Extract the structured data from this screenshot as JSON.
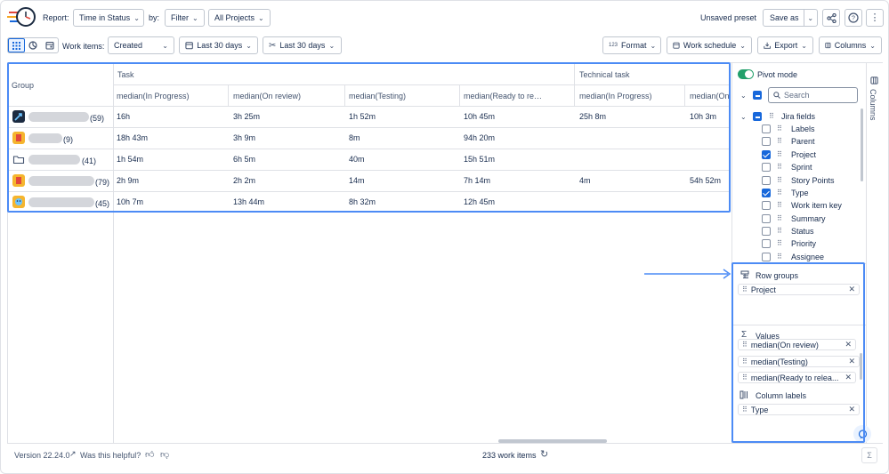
{
  "toolbar": {
    "report_label": "Report:",
    "report_value": "Time in Status",
    "by_label": "by:",
    "filter_value": "Filter",
    "projects_value": "All Projects",
    "unsaved_preset": "Unsaved preset",
    "save_as": "Save as"
  },
  "subbar": {
    "work_items_label": "Work items:",
    "created_value": "Created",
    "date1": "Last 30 days",
    "date2": "Last 30 days",
    "format_prefix": "123",
    "format": "Format",
    "work_schedule": "Work schedule",
    "export": "Export",
    "columns": "Columns"
  },
  "table": {
    "group_header": "Group",
    "type_headers": [
      "Task",
      "Technical task"
    ],
    "columns": [
      "median(In Progress)",
      "median(On review)",
      "median(Testing)",
      "median(Ready to re…",
      "median(In Progress)",
      "median(On"
    ],
    "rows": [
      {
        "count": "(59)",
        "cells": [
          "16h",
          "3h 25m",
          "1h 52m",
          "10h 45m",
          "25h 8m",
          "10h 3m"
        ]
      },
      {
        "count": "(9)",
        "cells": [
          "18h 43m",
          "3h 9m",
          "8m",
          "94h 20m",
          "",
          ""
        ]
      },
      {
        "count": "(41)",
        "cells": [
          "1h 54m",
          "6h 5m",
          "40m",
          "15h 51m",
          "",
          ""
        ]
      },
      {
        "count": "(79)",
        "cells": [
          "2h 9m",
          "2h 2m",
          "14m",
          "7h 14m",
          "4m",
          "54h 52m"
        ]
      },
      {
        "count": "(45)",
        "cells": [
          "10h 7m",
          "13h 44m",
          "8h 32m",
          "12h 45m",
          "",
          ""
        ]
      }
    ]
  },
  "panel": {
    "pivot_mode": "Pivot mode",
    "search_placeholder": "Search",
    "jira_fields": "Jira fields",
    "side_tab": "Columns",
    "fields": [
      {
        "label": "Labels",
        "checked": false
      },
      {
        "label": "Parent",
        "checked": false
      },
      {
        "label": "Project",
        "checked": true
      },
      {
        "label": "Sprint",
        "checked": false
      },
      {
        "label": "Story Points",
        "checked": false
      },
      {
        "label": "Type",
        "checked": true
      },
      {
        "label": "Work item key",
        "checked": false
      },
      {
        "label": "Summary",
        "checked": false
      },
      {
        "label": "Status",
        "checked": false
      },
      {
        "label": "Priority",
        "checked": false
      },
      {
        "label": "Assignee",
        "checked": false
      }
    ],
    "row_groups_title": "Row groups",
    "row_groups": [
      "Project"
    ],
    "values_title": "Values",
    "values": [
      "median(On review)",
      "median(Testing)",
      "median(Ready to relea..."
    ],
    "column_labels_title": "Column labels",
    "column_labels": [
      "Type"
    ]
  },
  "footer": {
    "version": "Version 22.24.0",
    "helpful": "Was this helpful?",
    "work_items": "233 work items"
  },
  "colors": {
    "accent": "#1868db",
    "highlight_border": "#4c8bf5",
    "toggle_green": "#22a06b"
  }
}
